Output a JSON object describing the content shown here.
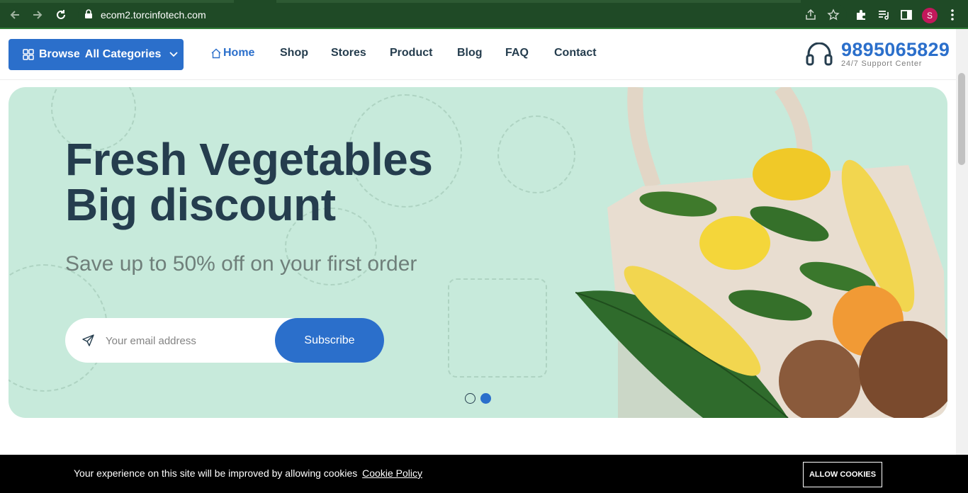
{
  "browser": {
    "url": "ecom2.torcinfotech.com",
    "profile_initial": "S"
  },
  "header": {
    "browse_label": "Browse",
    "browse_label_bold": "All Categories",
    "nav": [
      "Home",
      "Shop",
      "Stores",
      "Product",
      "Blog",
      "FAQ",
      "Contact"
    ],
    "active_nav": "Home",
    "phone": "9895065829",
    "support_label": "24/7 Support Center"
  },
  "hero": {
    "title_line1": "Fresh Vegetables",
    "title_line2": "Big discount",
    "subtitle": "Save up to 50% off on your first order",
    "email_placeholder": "Your email address",
    "subscribe_label": "Subscribe",
    "slide_count": 2,
    "active_slide": 2
  },
  "cookie": {
    "message": "Your experience on this site will be improved by allowing cookies",
    "policy_link": "Cookie Policy",
    "allow_label": "ALLOW COOKIES"
  },
  "colors": {
    "brand": "#2b6fcb",
    "heading": "#253d4e",
    "hero_bg": "#c7eadb",
    "chrome_bg": "#1f4a26"
  }
}
